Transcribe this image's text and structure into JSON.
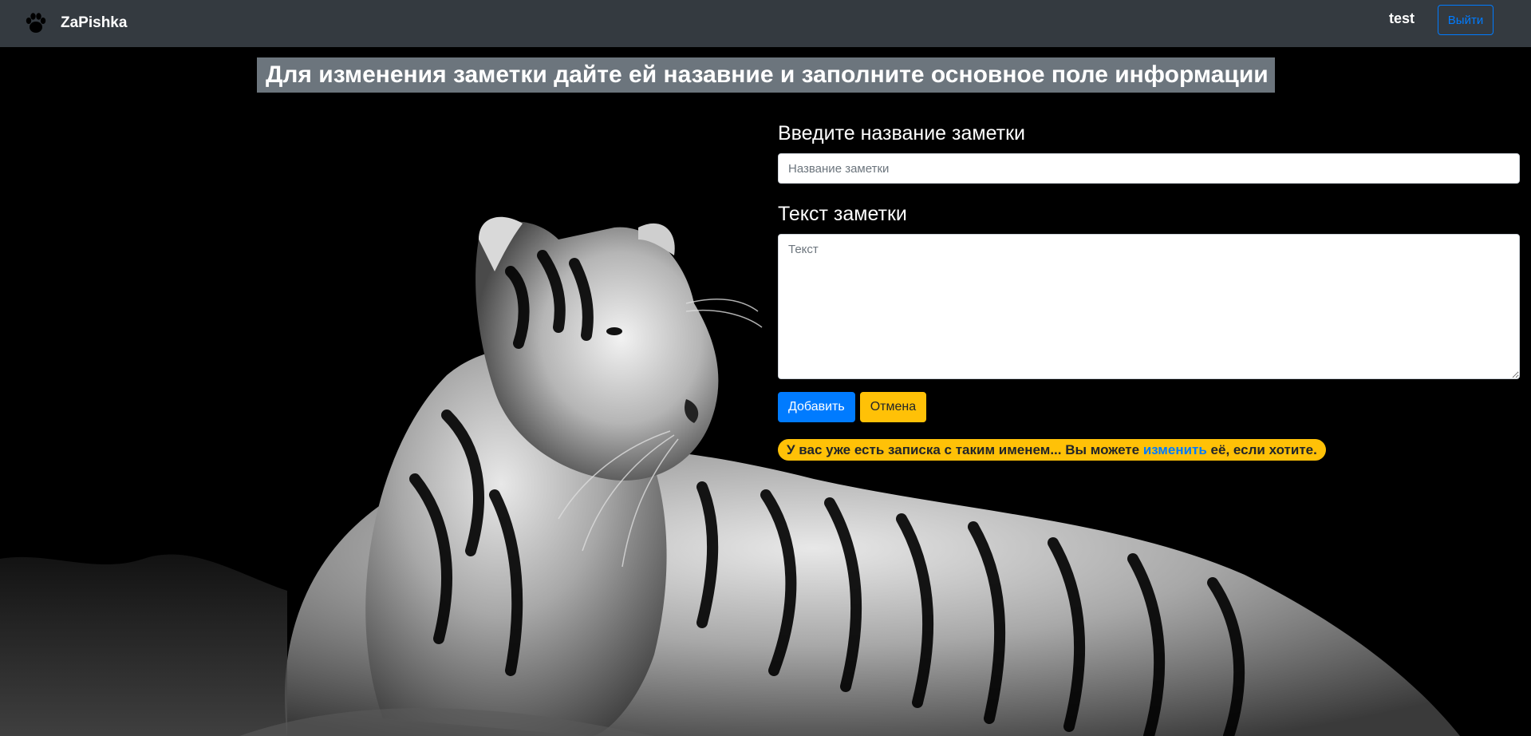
{
  "navbar": {
    "brand_name": "ZaPishka",
    "brand_icon": "paw-icon",
    "user_name": "test",
    "logout_label": "Выйти"
  },
  "page": {
    "title": "Для изменения заметки дайте ей назавние и заполните основное поле информации"
  },
  "form": {
    "title_label": "Введите название заметки",
    "title_value": "",
    "title_placeholder": "Название заметки",
    "text_label": "Текст заметки",
    "text_value": "",
    "text_placeholder": "Текст",
    "add_label": "Добавить",
    "cancel_label": "Отмена"
  },
  "alert": {
    "text_before": "У вас уже есть записка с таким именем... Вы можете ",
    "link_text": "изменить",
    "text_after": " её, если хотите."
  },
  "colors": {
    "navbar_bg": "#343a40",
    "title_bg": "#6c757d",
    "primary": "#007bff",
    "warning": "#ffc107"
  }
}
